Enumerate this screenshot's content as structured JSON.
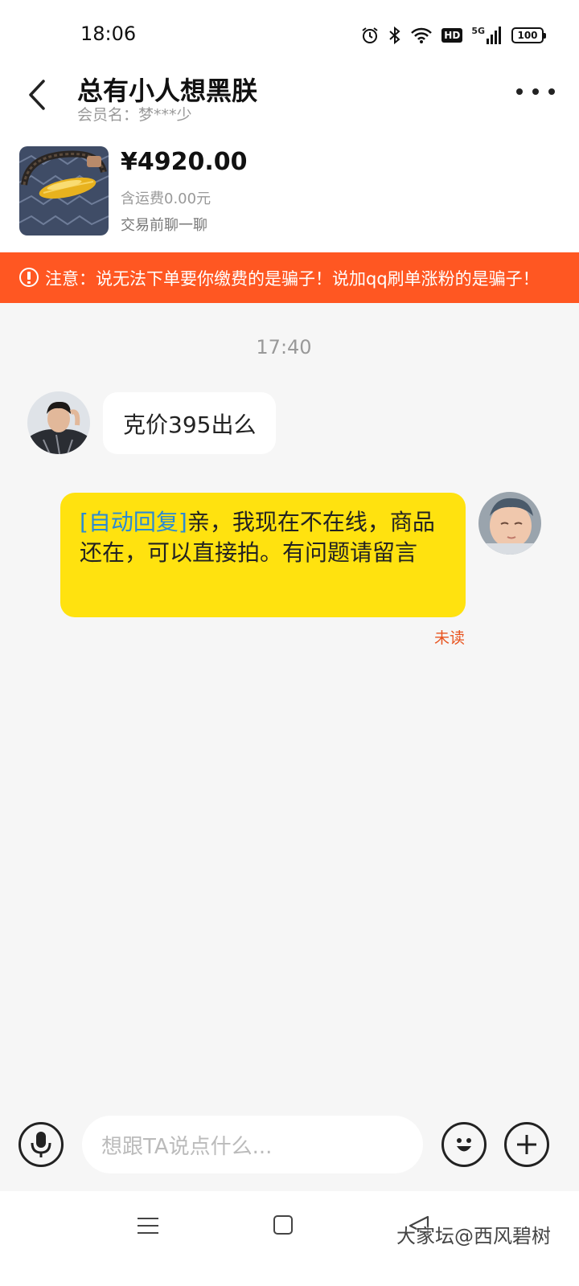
{
  "status_bar": {
    "time": "18:06",
    "network": "5G",
    "hd_badge": "HD",
    "battery": "100"
  },
  "header": {
    "title": "总有小人想黑朕",
    "member_label": "会员名：",
    "member_name": "梦***少"
  },
  "product": {
    "price": "¥4920.00",
    "shipping": "含运费0.00元",
    "chat_hint": "交易前聊一聊"
  },
  "warning": {
    "text": "注意：说无法下单要你缴费的是骗子！说加qq刷单涨粉的是骗子！"
  },
  "chat": {
    "timestamp": "17:40",
    "incoming_message": "克价395出么",
    "outgoing_tag": "[自动回复]",
    "outgoing_message": "亲，我现在不在线，商品还在，可以直接拍。有问题请留言",
    "read_status": "未读"
  },
  "input": {
    "placeholder": "想跟TA说点什么..."
  },
  "watermark": "大家坛@西风碧树",
  "colors": {
    "warning_bg": "#ff5722",
    "outgoing_bubble": "#ffe20f",
    "auto_reply_tag": "#2a8ad4",
    "unread_text": "#e8541f"
  }
}
